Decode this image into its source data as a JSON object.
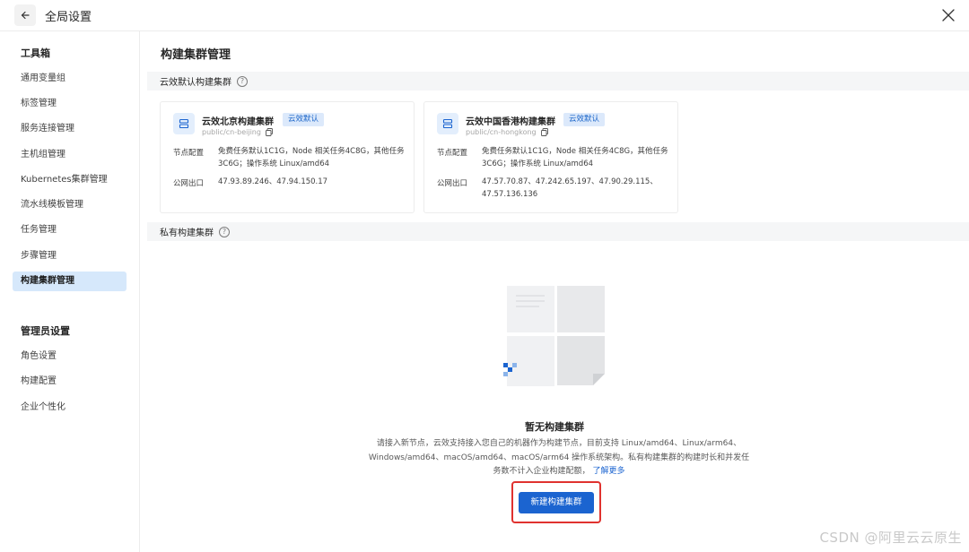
{
  "header": {
    "title": "全局设置"
  },
  "sidebar": {
    "groups": [
      {
        "title": "工具箱",
        "items": [
          "通用变量组",
          "标签管理",
          "服务连接管理",
          "主机组管理",
          "Kubernetes集群管理",
          "流水线模板管理",
          "任务管理",
          "步骤管理",
          "构建集群管理"
        ]
      },
      {
        "title": "管理员设置",
        "items": [
          "角色设置",
          "构建配置",
          "企业个性化"
        ]
      }
    ],
    "active_item": "构建集群管理"
  },
  "main": {
    "title": "构建集群管理",
    "default_section": "云效默认构建集群",
    "private_section": "私有构建集群",
    "help_glyph": "?",
    "clusters": [
      {
        "name": "云效北京构建集群",
        "badge": "云效默认",
        "id": "public/cn-beijing",
        "node_label": "节点配置",
        "node_value": "免费任务默认1C1G，Node 相关任务4C8G，其他任务3C6G；操作系统 Linux/amd64",
        "egress_label": "公网出口",
        "egress_value": "47.93.89.246、47.94.150.17"
      },
      {
        "name": "云效中国香港构建集群",
        "badge": "云效默认",
        "id": "public/cn-hongkong",
        "node_label": "节点配置",
        "node_value": "免费任务默认1C1G，Node 相关任务4C8G，其他任务3C6G；操作系统 Linux/amd64",
        "egress_label": "公网出口",
        "egress_value": "47.57.70.87、47.242.65.197、47.90.29.115、47.57.136.136"
      }
    ],
    "empty": {
      "title": "暂无构建集群",
      "description": "请接入新节点，云效支持接入您自己的机器作为构建节点，目前支持 Linux/amd64、Linux/arm64、Windows/amd64、macOS/amd64、macOS/arm64 操作系统架构。私有构建集群的构建时长和并发任务数不计入企业构建配额，",
      "link": "了解更多",
      "button": "新建构建集群"
    }
  },
  "watermark": "CSDN @阿里云云原生",
  "colors": {
    "accent": "#1b64d0",
    "active_bg": "#d6e8fb",
    "highlight": "#e0322f"
  },
  "icons": [
    "back-arrow-icon",
    "close-icon",
    "help-icon",
    "cluster-icon",
    "copy-icon",
    "empty-illustration"
  ]
}
